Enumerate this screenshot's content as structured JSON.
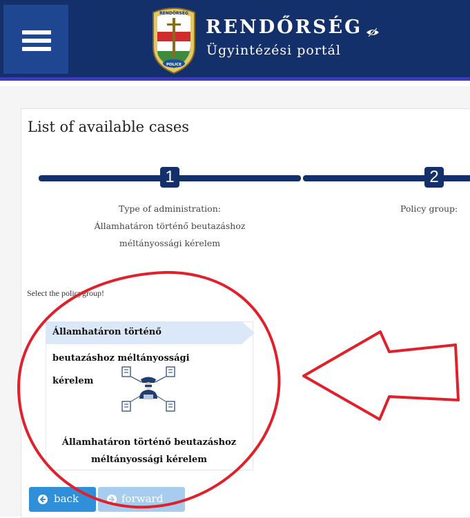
{
  "header": {
    "title": "RENDŐRSÉG",
    "subtitle": "Ügyintézési portál",
    "crest_text_top": "RENDŐRSÉG",
    "crest_text_bottom": "POLICE",
    "icons": [
      "menu-icon",
      "police-crest-logo",
      "eye-slash-icon"
    ],
    "colors": {
      "bar": "#14306b",
      "menu": "#1f4690",
      "stripe": "#3b3db8"
    }
  },
  "main": {
    "title": "List of available cases",
    "steps": [
      {
        "number": "1",
        "caption": [
          "Type of administration:",
          "Államhatáron történő beutazáshoz",
          "méltányossági kérelem"
        ]
      },
      {
        "number": "2",
        "caption": [
          "Policy group:"
        ]
      }
    ],
    "select_label": "Select the policygroup!",
    "card": {
      "banner": "Államhatáron történő",
      "lines": [
        "beutazáshoz méltányossági",
        "kérelem"
      ],
      "footer": [
        "Államhatáron történő beutazáshoz",
        "méltányossági kérelem"
      ],
      "icon": "officer-documents-icon"
    },
    "buttons": {
      "back": "back",
      "forward": "forward"
    }
  },
  "annotation": {
    "color": "#e0202a",
    "shapes": [
      "ellipse",
      "left-arrow"
    ]
  }
}
